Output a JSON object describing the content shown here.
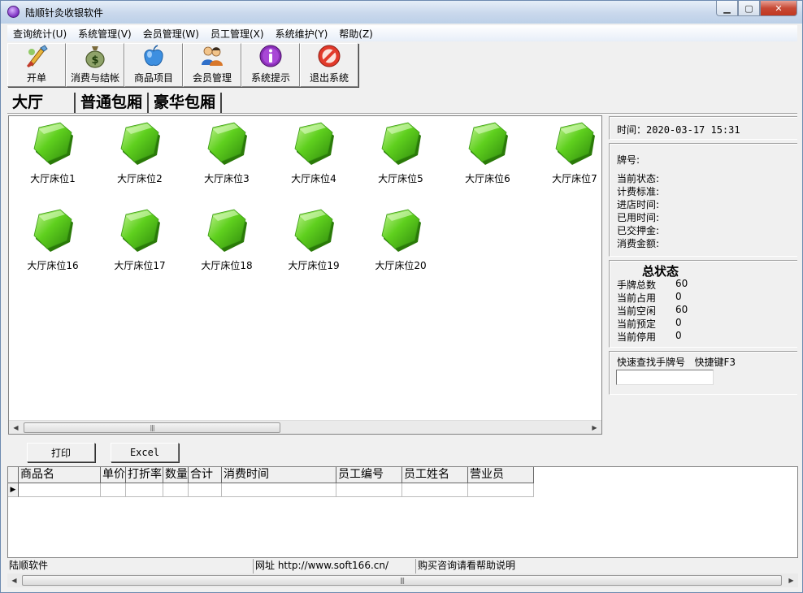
{
  "window": {
    "title": "陆顺针灸收银软件",
    "min_label": "▁",
    "max_label": "▢",
    "close_label": "✕"
  },
  "menu": [
    "查询统计(U)",
    "系统管理(V)",
    "会员管理(W)",
    "员工管理(X)",
    "系统维护(Y)",
    "帮助(Z)"
  ],
  "toolbar": [
    {
      "label": "开单",
      "icon": "brush-icon"
    },
    {
      "label": "消费与结帐",
      "icon": "money-bag-icon"
    },
    {
      "label": "商品项目",
      "icon": "apple-icon"
    },
    {
      "label": "会员管理",
      "icon": "users-icon"
    },
    {
      "label": "系统提示",
      "icon": "info-icon"
    },
    {
      "label": "退出系统",
      "icon": "exit-icon"
    }
  ],
  "tabs": [
    "大厅",
    "普通包厢",
    "豪华包厢"
  ],
  "beds": [
    "大厅床位1",
    "大厅床位2",
    "大厅床位3",
    "大厅床位4",
    "大厅床位5",
    "大厅床位6",
    "大厅床位7",
    "大厅床位16",
    "大厅床位17",
    "大厅床位18",
    "大厅床位19",
    "大厅床位20"
  ],
  "bed_color": "#5fd01e",
  "info": {
    "time_label": "时间：",
    "time_value": "2020-03-17 15:31",
    "card_label": "牌号:",
    "fields": [
      "当前状态:",
      "计费标准:",
      "进店时间:",
      "已用时间:",
      "已交押金:",
      "消费金额:"
    ]
  },
  "summary": {
    "title": "总状态",
    "rows": [
      {
        "k": "手牌总数",
        "v": "60"
      },
      {
        "k": "当前占用",
        "v": "0"
      },
      {
        "k": "当前空闲",
        "v": "60"
      },
      {
        "k": "当前预定",
        "v": "0"
      },
      {
        "k": "当前停用",
        "v": "0"
      }
    ]
  },
  "quick_search": {
    "label": "快速查找手牌号",
    "hotkey": "快捷键F3",
    "value": ""
  },
  "buttons": {
    "print": "打印",
    "excel": "Excel"
  },
  "table": {
    "columns": [
      "商品名",
      "单价",
      "打折率",
      "数量",
      "合计",
      "消费时间",
      "员工编号",
      "员工姓名",
      "营业员"
    ],
    "row_marker": "▶"
  },
  "statusbar": [
    "陆顺软件",
    "网址 http://www.soft166.cn/",
    "购买咨询请看帮助说明"
  ],
  "scroll_grip": "|||",
  "scroll_left": "◀",
  "scroll_right": "▶"
}
